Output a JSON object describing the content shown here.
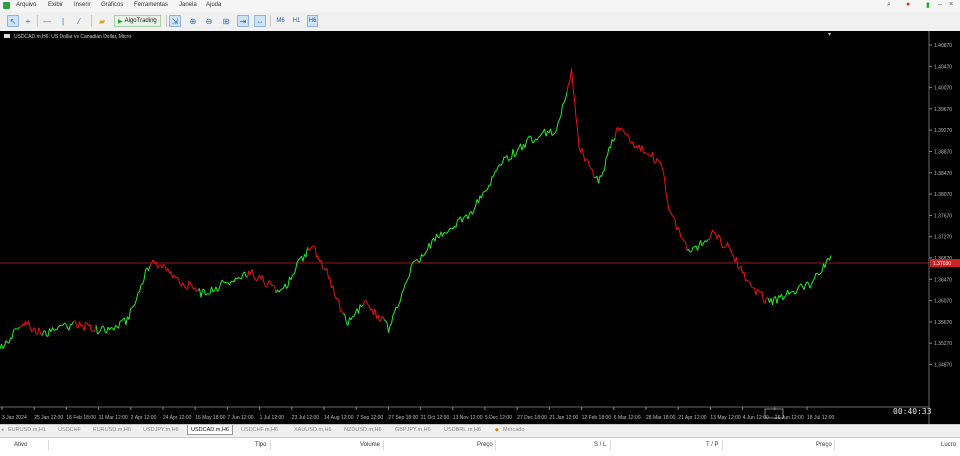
{
  "menu": {
    "items": [
      "Arquivo",
      "Exibir",
      "Inserir",
      "Gráficos",
      "Ferramentas",
      "Janela",
      "Ajuda"
    ]
  },
  "toolbar": {
    "algo_label": "AlgoTrading",
    "timeframes": [
      "M6",
      "H1",
      "H6"
    ],
    "active_timeframe": "H6"
  },
  "chart": {
    "title": "USDCAD.m,H6: US Dollar vs Canadian Dollar, Micro",
    "countdown": "00:40:33",
    "current_price": "1.37030",
    "price_labels": [
      "1.40870",
      "1.40470",
      "1.40070",
      "1.39670",
      "1.39270",
      "1.38870",
      "1.38470",
      "1.38070",
      "1.37670",
      "1.37270",
      "1.37030",
      "1.36870",
      "1.36470",
      "1.36070",
      "1.35670",
      "1.35270",
      "1.34870"
    ],
    "date_labels": [
      "3 Jan 2024",
      "25 Jan 12:00",
      "16 Feb 18:00",
      "11 Mar 12:00",
      "2 Apr 12:00",
      "24 Apr 12:00",
      "16 May 18:00",
      "7 Jun 12:00",
      "1 Jul 12:00",
      "23 Jul 12:00",
      "14 Aug 12:00",
      "7 Sep 12:00",
      "27 Sep 18:00",
      "21 Oct 12:00",
      "13 Nov 12:00",
      "5 Dec 12:00",
      "27 Dec 18:00",
      "21 Jan 12:00",
      "12 Feb 18:00",
      "6 Mar 12:00",
      "28 Mar 18:00",
      "21 Apr 12:00",
      "13 May 12:00",
      "4 Jun 12:00",
      "26 Jun 12:00",
      "18 Jul 12:00"
    ],
    "colors": {
      "up": "#22ee22",
      "down": "#ee1111",
      "background": "#000000",
      "axis_text": "#bbbbbb",
      "price_line": "#cc2222"
    }
  },
  "symbol_tabs": [
    "EURUSD.m,H1",
    "USDCHF",
    "EURUSD.m,H6",
    "USDJPY.m,H6",
    "USDCAD.m,H6",
    "USDCHF.m,H6",
    "XAUUSD.m,H6",
    "NZDUSD.m,H6",
    "GBPJPY.m,H6",
    "USDBRL.m,H6",
    "Mercado"
  ],
  "active_tab": "USDCAD.m,H6",
  "terminal": {
    "columns": [
      "Ativo",
      "Tipo",
      "Volume",
      "Preço",
      "S / L",
      "T / P",
      "Preço",
      "Lucro"
    ]
  }
}
